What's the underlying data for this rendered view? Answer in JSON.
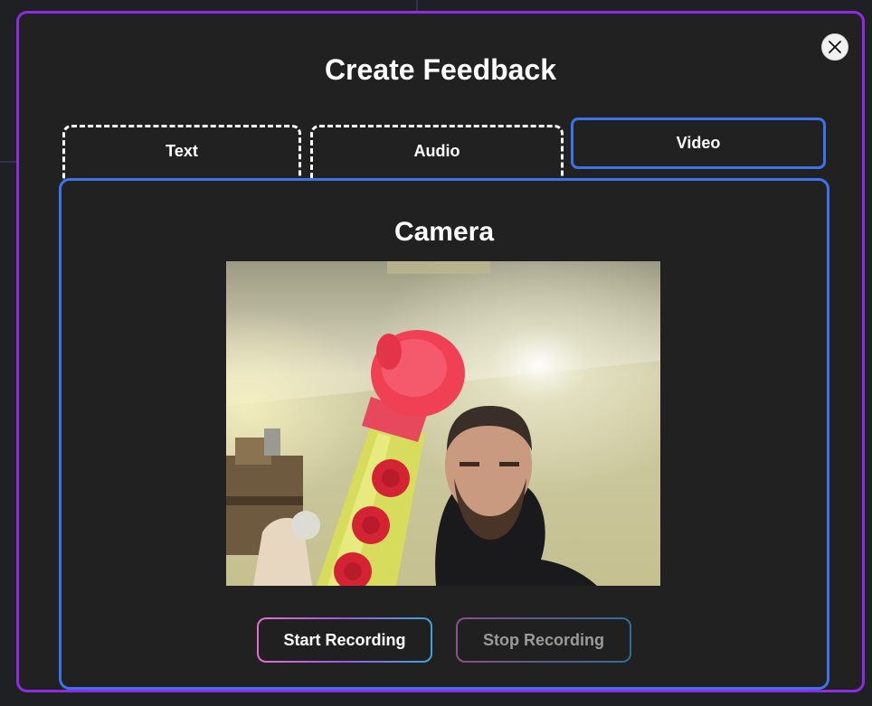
{
  "modal": {
    "title": "Create Feedback",
    "close_icon": "close-icon"
  },
  "tabs": [
    {
      "label": "Text",
      "active": false
    },
    {
      "label": "Audio",
      "active": false
    },
    {
      "label": "Video",
      "active": true
    }
  ],
  "panel": {
    "title": "Camera",
    "start_label": "Start Recording",
    "stop_label": "Stop Recording",
    "stop_enabled": false
  },
  "colors": {
    "modal_border": "#8f2be0",
    "active_blue": "#3d73e8",
    "background": "#212121"
  }
}
